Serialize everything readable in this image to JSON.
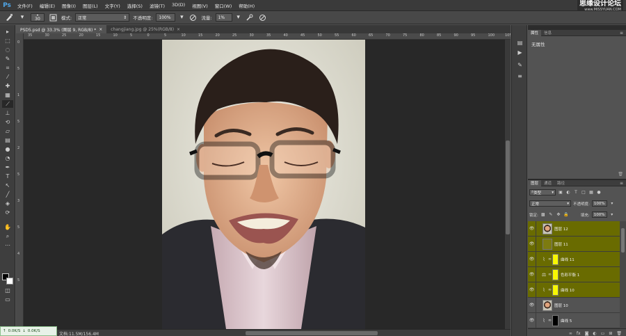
{
  "app": {
    "logo": "Ps"
  },
  "menu": [
    "文件(F)",
    "编辑(E)",
    "图像(I)",
    "图层(L)",
    "文字(Y)",
    "选择(S)",
    "滤镜(T)",
    "3D(D)",
    "视图(V)",
    "窗口(W)",
    "帮助(H)"
  ],
  "watermark": {
    "title": "思缘设计论坛",
    "url": "www.MISSYUAN.COM"
  },
  "options": {
    "brush_size": "30",
    "mode_label": "模式:",
    "mode_value": "正常",
    "opacity_label": "不透明度:",
    "opacity_value": "100%",
    "flow_label": "流量:",
    "flow_value": "1%"
  },
  "tabs": [
    {
      "label": "PSD5.psd @ 33.3% (图层 9, RGB/8) *",
      "active": true
    },
    {
      "label": "changjiang.jpg @ 25%(RGB/8)",
      "active": false
    }
  ],
  "ruler_h": [
    "35",
    "30",
    "25",
    "20",
    "15",
    "10",
    "5",
    "0",
    "5",
    "10",
    "15",
    "20",
    "25",
    "30",
    "35",
    "40",
    "45",
    "50",
    "55",
    "60",
    "65",
    "70",
    "75",
    "80",
    "85",
    "90",
    "95",
    "100",
    "105"
  ],
  "ruler_v": [
    "0",
    "5",
    "1",
    "5",
    "2",
    "5",
    "3",
    "5",
    "4",
    "5"
  ],
  "status": {
    "doc": "文档:11.5M/156.4M"
  },
  "net_widget": {
    "upload": "0.0K/S",
    "download": "0.0K/S"
  },
  "properties": {
    "tabs": [
      "属性",
      "信息"
    ],
    "body": "无属性"
  },
  "layers_panel": {
    "tabs": [
      "图层",
      "通道",
      "路径"
    ],
    "filter_label": "类型",
    "blend_mode": "正常",
    "opacity_label": "不透明度:",
    "opacity_value": "100%",
    "lock_label": "锁定:",
    "fill_label": "填充:",
    "fill_value": "100%",
    "layers": [
      {
        "name": "图层 12",
        "kind": "pixel",
        "thumb": "face",
        "selected": true
      },
      {
        "name": "图层 11",
        "kind": "pixel",
        "thumb": "olive",
        "selected": true
      },
      {
        "name": "曲线 11",
        "kind": "adjustment",
        "icon": "curves-icon",
        "mask": "#f7f700",
        "selected": true
      },
      {
        "name": "色彩平衡 1",
        "kind": "adjustment",
        "icon": "balance-icon",
        "mask": "#f7f700",
        "selected": true
      },
      {
        "name": "曲线 10",
        "kind": "adjustment",
        "icon": "curves-icon",
        "mask": "#f7f700",
        "selected": true
      },
      {
        "name": "图层 10",
        "kind": "pixel",
        "thumb": "face",
        "selected": false
      },
      {
        "name": "曲线 5",
        "kind": "adjustment",
        "icon": "curves-icon",
        "mask": "#000000",
        "selected": false
      }
    ]
  },
  "colors": {
    "accent_selected": "#696b00",
    "mask_yellow": "#f7f700"
  }
}
